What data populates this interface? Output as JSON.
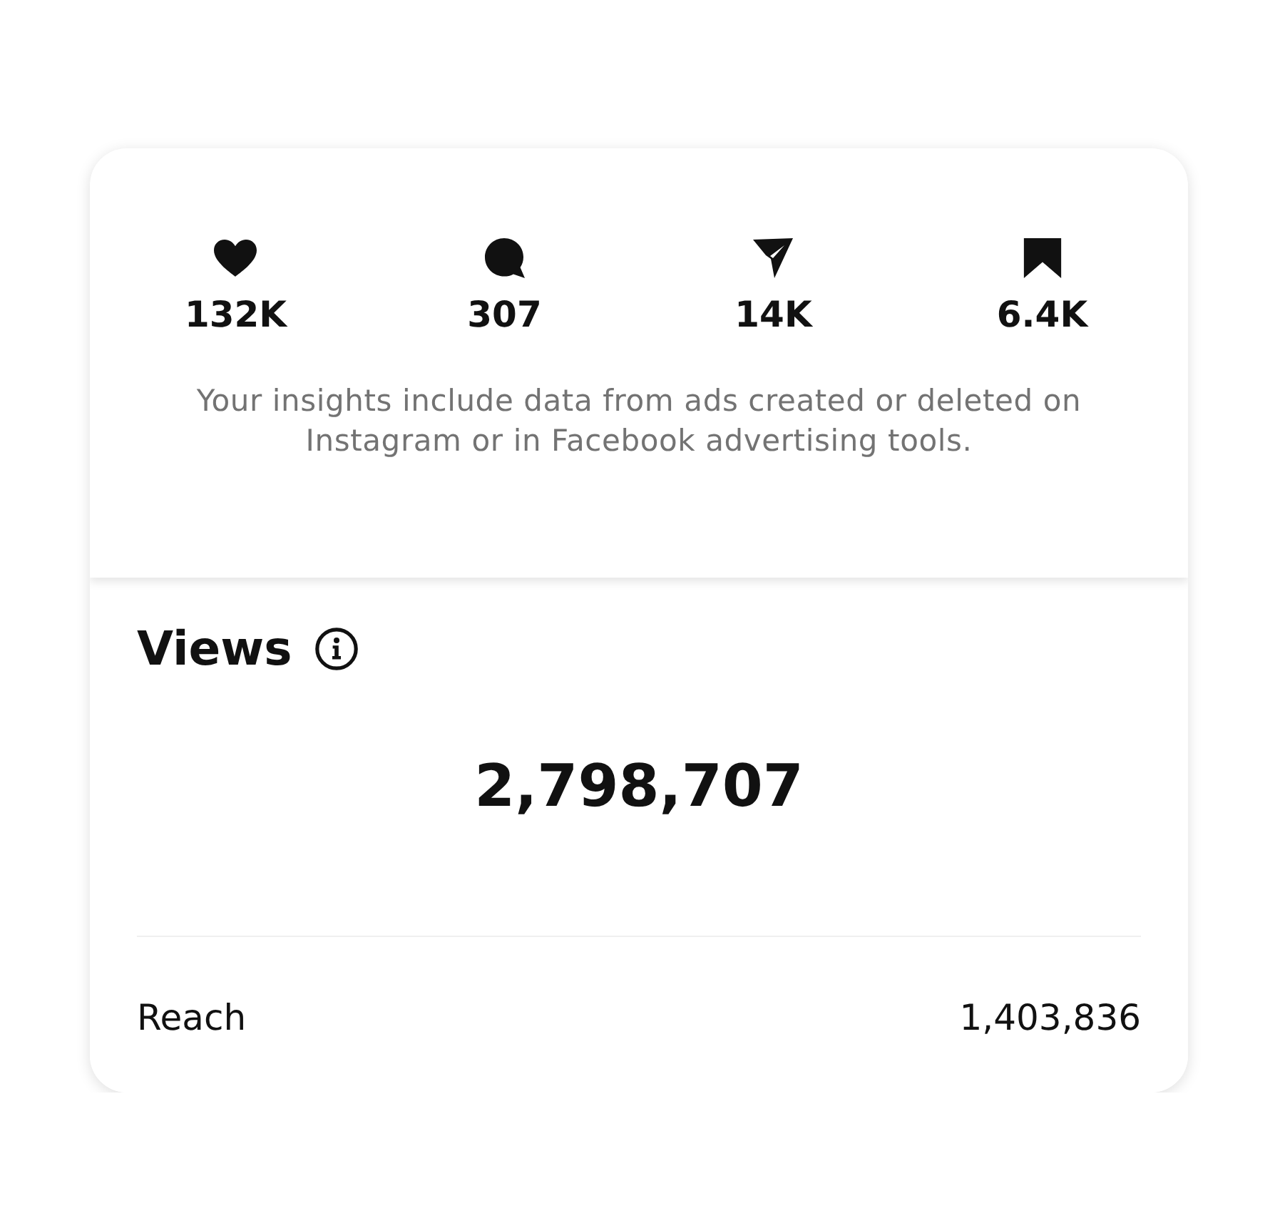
{
  "stats": [
    {
      "kind": "likes",
      "value": "132K"
    },
    {
      "kind": "comments",
      "value": "307"
    },
    {
      "kind": "shares",
      "value": "14K"
    },
    {
      "kind": "saves",
      "value": "6.4K"
    }
  ],
  "note": "Your insights include data from ads created or deleted on Instagram or in Facebook advertising tools.",
  "views": {
    "title": "Views",
    "total": "2,798,707"
  },
  "metrics": [
    {
      "label": "Reach",
      "value": "1,403,836"
    }
  ]
}
